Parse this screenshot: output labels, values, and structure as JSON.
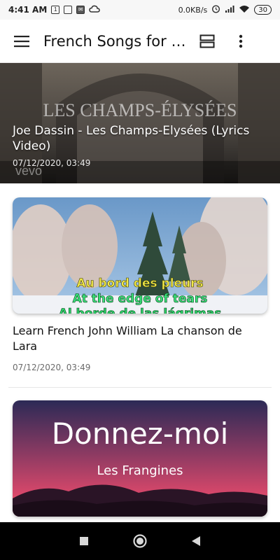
{
  "status_bar": {
    "time": "4:41 AM",
    "speed": "0.0KB/s",
    "battery": "30",
    "icons": [
      "sim-icon",
      "gallery-icon",
      "mail-icon",
      "cloud-icon",
      "alarm-icon",
      "signal-icon",
      "wifi-icon",
      "battery-icon"
    ]
  },
  "app_bar": {
    "title": "French Songs for b...",
    "menu_icon": "hamburger-menu-icon",
    "view_icon": "view-toggle-icon",
    "more_icon": "more-vert-icon"
  },
  "featured": {
    "thumb_text": "LES CHAMPS-ÉLYSÉES",
    "watermark": "vevo",
    "title": "Joe Dassin - Les Champs-Elysées (Lyrics Video)",
    "date": "07/12/2020, 03:49"
  },
  "cards": [
    {
      "thumb_lines": [
        "Au bord des pleurs",
        "At the edge of tears",
        "Al borde de las lágrimas"
      ],
      "title": "Learn French John William La chanson de Lara",
      "date": "07/12/2020, 03:49"
    },
    {
      "thumb_title": "Donnez-moi",
      "thumb_subtitle": "Les Frangines"
    }
  ],
  "nav_bar": {
    "icons": [
      "recents-square-icon",
      "home-circle-icon",
      "back-triangle-icon"
    ]
  }
}
